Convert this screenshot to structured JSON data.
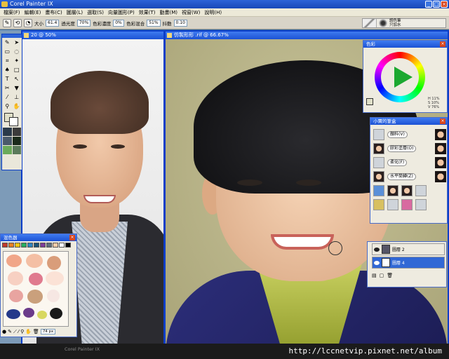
{
  "app": {
    "title": "Corel Painter IX"
  },
  "window_buttons": {
    "minimize": "_",
    "maximize": "□",
    "close": "×"
  },
  "menu": [
    "檔案(F)",
    "編輯(E)",
    "畫布(C)",
    "圖層(L)",
    "選取(S)",
    "向量圖形(P)",
    "效果(T)",
    "動畫(M)",
    "視窗(W)",
    "說明(H)"
  ],
  "propbar": {
    "size_label": "大小",
    "size_value": "61.4",
    "opacity_label": "透光度",
    "opacity_value": "70%",
    "resat_label": "色彩濃度",
    "resat_value": "0%",
    "bleed_label": "色彩混合",
    "bleed_value": "51%",
    "jitter_label": "抖動",
    "jitter_value": "0.10",
    "brush_category": "調色筆",
    "brush_variant": "只加水"
  },
  "documents": [
    {
      "title": "20 @ 50%"
    },
    {
      "title": "仿製形形 .rif @ 66.67%"
    }
  ],
  "panels": {
    "mixer_title": "混色器",
    "mixer_size": "74 px",
    "color_title": "色彩",
    "hsv": [
      "H 11%",
      "S 10%",
      "V 76%"
    ],
    "brushes_title": "小賈的筆盒",
    "brush_buttons": [
      "顏料(V)",
      "膠彩塗層(O)",
      "柔化(F)",
      "水平筒轉(Z)"
    ],
    "layers": [
      {
        "name": "圖層 2"
      },
      {
        "name": "圖層 4"
      }
    ]
  },
  "colors": {
    "accent": "#0c3ec8",
    "mixer_swatches": [
      "#c0392b",
      "#e67e22",
      "#f1c40f",
      "#27ae60",
      "#2e86c1",
      "#1a5276",
      "#7d3c98",
      "#5d6d7e",
      "#f5cba7",
      "#fff",
      "#000"
    ],
    "mixer_blobs": [
      "#f1a688",
      "#f4bfa4",
      "#d99d7a",
      "#f7d0c2",
      "#e07a8e",
      "#fbe2d6",
      "#e8a4a0",
      "#caa07c",
      "#f6e7e3",
      "#1a1a1a",
      "#243a8a",
      "#6b3b8a",
      "#d8d860"
    ]
  },
  "watermark": "http://lccnetvip.pixnet.net/album"
}
